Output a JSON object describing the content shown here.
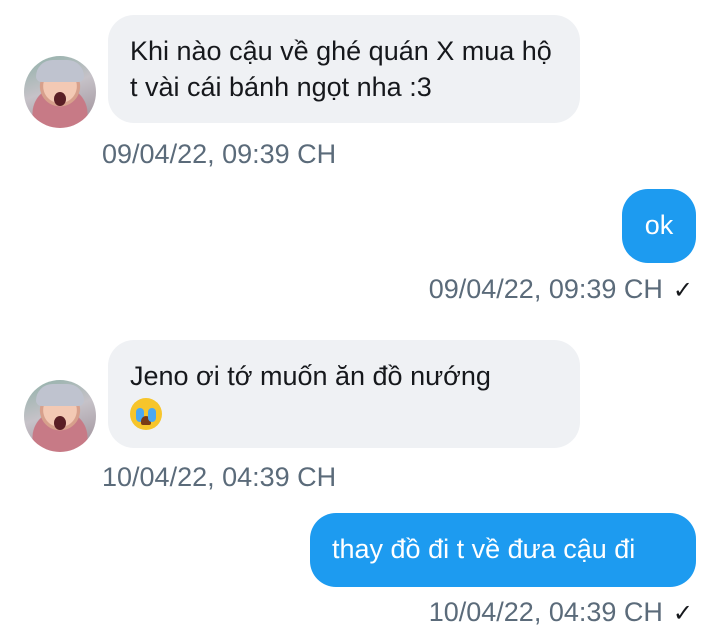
{
  "messages": [
    {
      "text": "Khi nào cậu về ghé quán X mua hộ t vài cái bánh ngọt nha :3",
      "time": "09/04/22, 09:39 CH"
    },
    {
      "text": "ok",
      "time": "09/04/22, 09:39 CH",
      "read_mark": "✓"
    },
    {
      "text": "Jeno ơi tớ muốn ăn đồ nướng",
      "emoji": "crying-face-emoji",
      "time": "10/04/22, 04:39 CH"
    },
    {
      "text": "thay đồ đi t về đưa cậu đi",
      "time": "10/04/22, 04:39 CH",
      "read_mark": "✓"
    }
  ],
  "colors": {
    "incoming_bubble": "#eff1f4",
    "outgoing_bubble": "#1d9bf0",
    "timestamp": "#5b6b7a"
  }
}
